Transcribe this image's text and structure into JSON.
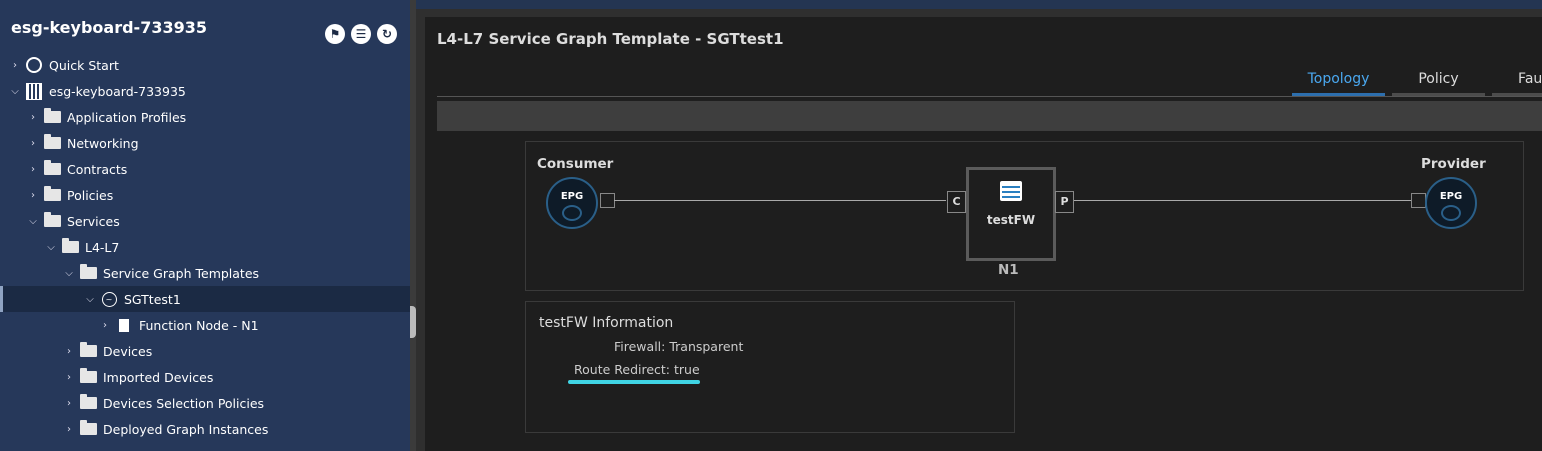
{
  "sidebar": {
    "title": "esg-keyboard-733935",
    "header_icons": [
      "flag-icon",
      "list-filter-icon",
      "refresh-icon"
    ],
    "tree": [
      {
        "label": "Quick Start",
        "icon": "quick-start-icon",
        "expand": ">",
        "depth": 0
      },
      {
        "label": "esg-keyboard-733935",
        "icon": "building-icon",
        "expand": "v",
        "depth": 0
      },
      {
        "label": "Application Profiles",
        "icon": "folder-icon",
        "expand": ">",
        "depth": 1
      },
      {
        "label": "Networking",
        "icon": "folder-icon",
        "expand": ">",
        "depth": 1
      },
      {
        "label": "Contracts",
        "icon": "folder-icon",
        "expand": ">",
        "depth": 1
      },
      {
        "label": "Policies",
        "icon": "folder-icon",
        "expand": ">",
        "depth": 1
      },
      {
        "label": "Services",
        "icon": "folder-icon",
        "expand": "v",
        "depth": 1
      },
      {
        "label": "L4-L7",
        "icon": "folder-icon",
        "expand": "v",
        "depth": 2
      },
      {
        "label": "Service Graph Templates",
        "icon": "folder-icon",
        "expand": "v",
        "depth": 3
      },
      {
        "label": "SGTtest1",
        "icon": "service-graph-icon",
        "expand": "v",
        "depth": 4,
        "selected": true
      },
      {
        "label": "Function Node - N1",
        "icon": "document-icon",
        "expand": ">",
        "depth": 5
      },
      {
        "label": "Devices",
        "icon": "folder-icon",
        "expand": ">",
        "depth": 3
      },
      {
        "label": "Imported Devices",
        "icon": "folder-icon",
        "expand": ">",
        "depth": 3
      },
      {
        "label": "Devices Selection Policies",
        "icon": "folder-icon",
        "expand": ">",
        "depth": 3
      },
      {
        "label": "Deployed Graph Instances",
        "icon": "folder-icon",
        "expand": ">",
        "depth": 3
      }
    ]
  },
  "main": {
    "title": "L4-L7 Service Graph Template - SGTtest1",
    "tabs": [
      {
        "label": "Topology",
        "active": true
      },
      {
        "label": "Policy",
        "active": false
      },
      {
        "label": "Faults",
        "active": false
      }
    ]
  },
  "topology": {
    "consumer_label": "Consumer",
    "provider_label": "Provider",
    "epg_label": "EPG",
    "consumer_port": "C",
    "provider_port": "P",
    "node_name": "testFW",
    "node_id": "N1"
  },
  "info": {
    "title": "testFW Information",
    "firewall_label": "Firewall:",
    "firewall_value": "Transparent",
    "route_redirect_label": "Route Redirect:",
    "route_redirect_value": "true"
  },
  "colors": {
    "sidebar_bg": "#26385a",
    "active_tab": "#4aa8f0",
    "highlight": "#40d4e4"
  }
}
